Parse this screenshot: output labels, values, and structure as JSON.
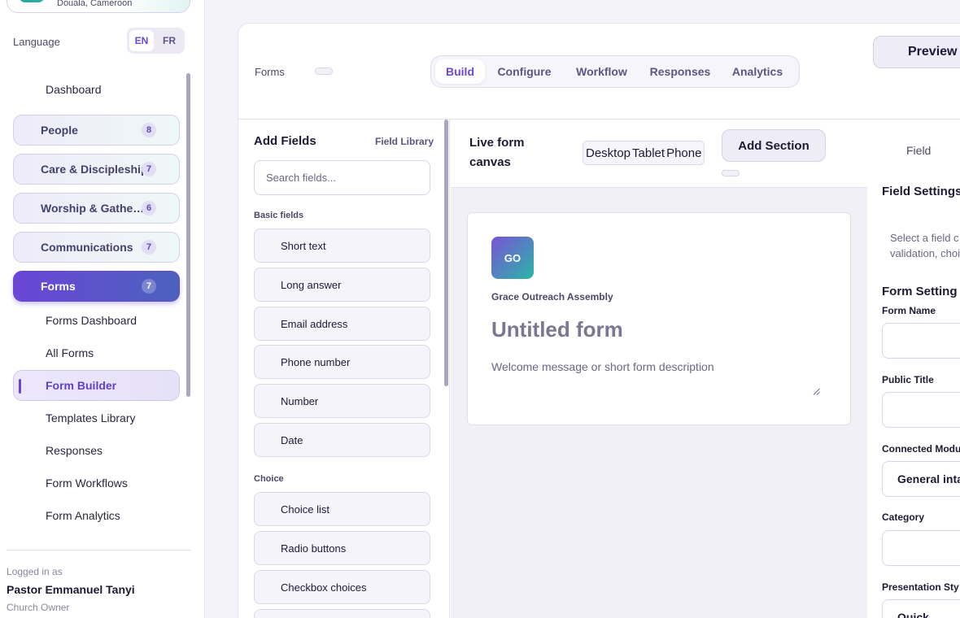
{
  "org": {
    "location": "Douala, Cameroon"
  },
  "language": {
    "label": "Language",
    "options": [
      "EN",
      "FR"
    ],
    "active": "EN"
  },
  "nav": {
    "dashboard": "Dashboard",
    "groups": [
      {
        "label": "People",
        "count": "8"
      },
      {
        "label": "Care & Discipleship",
        "count": "7"
      },
      {
        "label": "Worship & Gathe…",
        "count": "6"
      },
      {
        "label": "Communications",
        "count": "7"
      },
      {
        "label": "Forms",
        "count": "7"
      }
    ],
    "forms_sub": [
      "Forms Dashboard",
      "All Forms",
      "Form Builder",
      "Templates Library",
      "Responses",
      "Form Workflows",
      "Form Analytics"
    ]
  },
  "user": {
    "logged_label": "Logged in as",
    "name": "Pastor Emmanuel Tanyi",
    "role": "Church Owner"
  },
  "header": {
    "breadcrumb": "Forms",
    "tabs": [
      "Build",
      "Configure",
      "Workflow",
      "Responses",
      "Analytics"
    ],
    "active_tab": "Build",
    "preview_label": "Preview"
  },
  "palette": {
    "title": "Add Fields",
    "library_link": "Field Library",
    "search_placeholder": "Search fields...",
    "basic_label": "Basic fields",
    "basic_fields": [
      "Short text",
      "Long answer",
      "Email address",
      "Phone number",
      "Number",
      "Date"
    ],
    "choice_label": "Choice",
    "choice_fields": [
      "Choice list",
      "Radio buttons",
      "Checkbox choices"
    ]
  },
  "canvas": {
    "title": "Live form canvas",
    "devices": [
      "Desktop",
      "Tablet",
      "Phone"
    ],
    "add_section": "Add Section",
    "logo_text": "GO",
    "org_name": "Grace Outreach Assembly",
    "form_title": "Untitled form",
    "form_desc_placeholder": "Welcome message or short form description"
  },
  "settings": {
    "tab_label": "Field",
    "field_settings_heading": "Field Settings",
    "help_line1": "Select a field c",
    "help_line2": "validation, choi",
    "form_settings_heading": "Form Setting",
    "labels": [
      "Form Name",
      "Public Title",
      "Connected Modu",
      "Category",
      "Presentation Sty"
    ],
    "connected_value": "General inta",
    "presentation_value": "Quick"
  },
  "colors": {
    "accent": "#6a47d8",
    "brand_teal": "#29b6a8"
  }
}
